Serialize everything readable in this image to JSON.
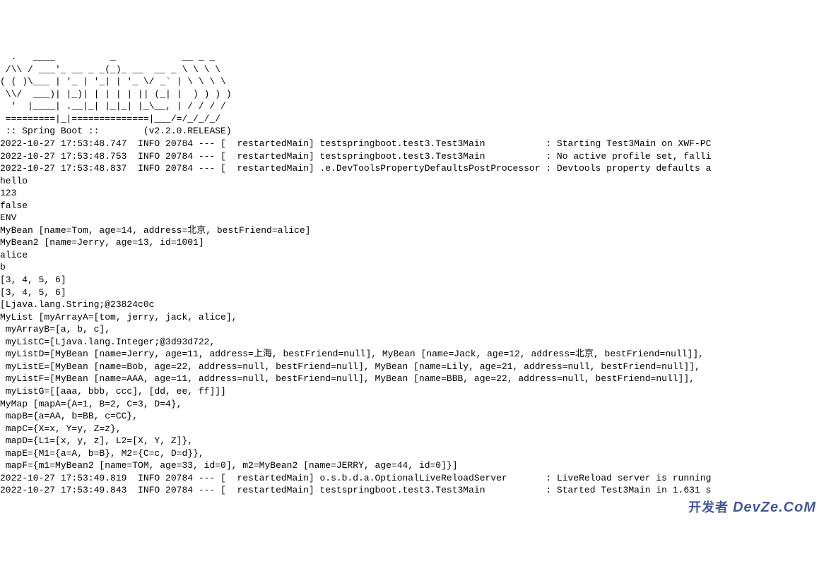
{
  "banner": [
    "  .   ____          _            __ _ _",
    " /\\\\ / ___'_ __ _ _(_)_ __  __ _ \\ \\ \\ \\",
    "( ( )\\___ | '_ | '_| | '_ \\/ _` | \\ \\ \\ \\",
    " \\\\/  ___)| |_)| | | | | || (_| |  ) ) ) )",
    "  '  |____| .__|_| |_|_| |_\\__, | / / / /",
    " =========|_|==============|___/=/_/_/_/",
    " :: Spring Boot ::        (v2.2.0.RELEASE)",
    ""
  ],
  "log_lines": [
    "2022-10-27 17:53:48.747  INFO 20784 --- [  restartedMain] testspringboot.test3.Test3Main           : Starting Test3Main on XWF-PC",
    "2022-10-27 17:53:48.753  INFO 20784 --- [  restartedMain] testspringboot.test3.Test3Main           : No active profile set, falli",
    "2022-10-27 17:53:48.837  INFO 20784 --- [  restartedMain] .e.DevToolsPropertyDefaultsPostProcessor : Devtools property defaults a"
  ],
  "output_lines": [
    "hello",
    "123",
    "false",
    "ENV",
    "MyBean [name=Tom, age=14, address=北京, bestFriend=alice]",
    "MyBean2 [name=Jerry, age=13, id=1001]",
    "alice",
    "b",
    "[3, 4, 5, 6]",
    "[3, 4, 5, 6]",
    "[Ljava.lang.String;@23824c0c",
    "MyList [myArrayA=[tom, jerry, jack, alice],",
    " myArrayB=[a, b, c],",
    " myListC=[Ljava.lang.Integer;@3d93d722,",
    " myListD=[MyBean [name=Jerry, age=11, address=上海, bestFriend=null], MyBean [name=Jack, age=12, address=北京, bestFriend=null]],",
    " myListE=[MyBean [name=Bob, age=22, address=null, bestFriend=null], MyBean [name=Lily, age=21, address=null, bestFriend=null]],",
    " myListF=[MyBean [name=AAA, age=11, address=null, bestFriend=null], MyBean [name=BBB, age=22, address=null, bestFriend=null]],",
    " myListG=[[aaa, bbb, ccc], [dd, ee, ff]]]",
    "MyMap [mapA={A=1, B=2, C=3, D=4},",
    " mapB={a=AA, b=BB, c=CC},",
    " mapC={X=x, Y=y, Z=z},",
    " mapD={L1=[x, y, z], L2=[X, Y, Z]},",
    " mapE={M1={a=A, b=B}, M2={C=c, D=d}},",
    " mapF={m1=MyBean2 [name=TOM, age=33, id=0], m2=MyBean2 [name=JERRY, age=44, id=0]}]"
  ],
  "trailing_log": [
    "2022-10-27 17:53:49.819  INFO 20784 --- [  restartedMain] o.s.b.d.a.OptionalLiveReloadServer       : LiveReload server is running ",
    "2022-10-27 17:53:49.843  INFO 20784 --- [  restartedMain] testspringboot.test3.Test3Main           : Started Test3Main in 1.631 s"
  ],
  "watermark": {
    "cn": "开发者",
    "en": "DevZe.CoM"
  }
}
